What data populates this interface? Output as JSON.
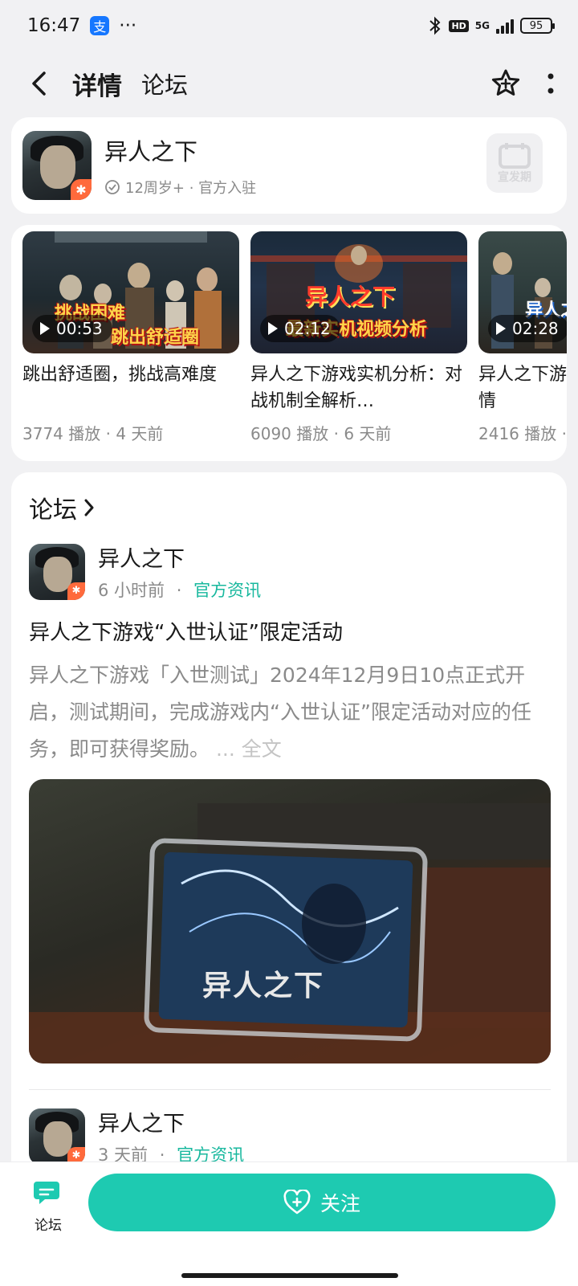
{
  "status_bar": {
    "time": "16:47",
    "app_icon_label": "支",
    "dots": "···",
    "network": "5G",
    "hd": "HD",
    "battery": "95",
    "icons": [
      "alipay-icon",
      "bluetooth-icon",
      "hd-icon",
      "signal-icon",
      "battery-icon"
    ]
  },
  "header": {
    "tabs": [
      {
        "label": "详情",
        "active": true
      },
      {
        "label": "论坛",
        "active": false
      }
    ],
    "icons": [
      "back-icon",
      "favorite-star-icon",
      "more-vertical-icon"
    ]
  },
  "game": {
    "title": "异人之下",
    "meta": "12周岁+ · 官方入驻",
    "release_badge": "宣发期",
    "accent": "#1ecab1"
  },
  "videos": [
    {
      "duration": "00:53",
      "overlay_1": "挑战困难",
      "overlay_2": "跳出舒适圈",
      "title": "跳出舒适圈，挑战高难度",
      "meta": "3774 播放 · 4 天前"
    },
    {
      "duration": "02:12",
      "overlay_1": "异人之下",
      "overlay_2": "最新实机视频分析",
      "title": "异人之下游戏实机分析：对战机制全解析…",
      "meta": "6090 播放 · 6 天前"
    },
    {
      "duration": "02:28",
      "overlay_1": "异人之",
      "overlay_2": "",
      "title": "异人之下游戏实机解析！剧情",
      "meta": "2416 播放 · "
    }
  ],
  "forum": {
    "heading": "论坛",
    "posts": [
      {
        "author": "异人之下",
        "time": "6 小时前",
        "sep": "·",
        "tag": "官方资讯",
        "title": "异人之下游戏“入世认证”限定活动",
        "body": "异人之下游戏「入世测试」2024年12月9日10点正式开启，测试期间，完成游戏内“入世认证”限定活动对应的任务，即可获得奖励。",
        "more": "... 全文",
        "image_caption": "异人之下"
      },
      {
        "author": "异人之下",
        "time": "3 天前",
        "sep": "·",
        "tag": "官方资讯"
      }
    ]
  },
  "bottom_bar": {
    "forum_label": "论坛",
    "follow_label": "关注"
  }
}
